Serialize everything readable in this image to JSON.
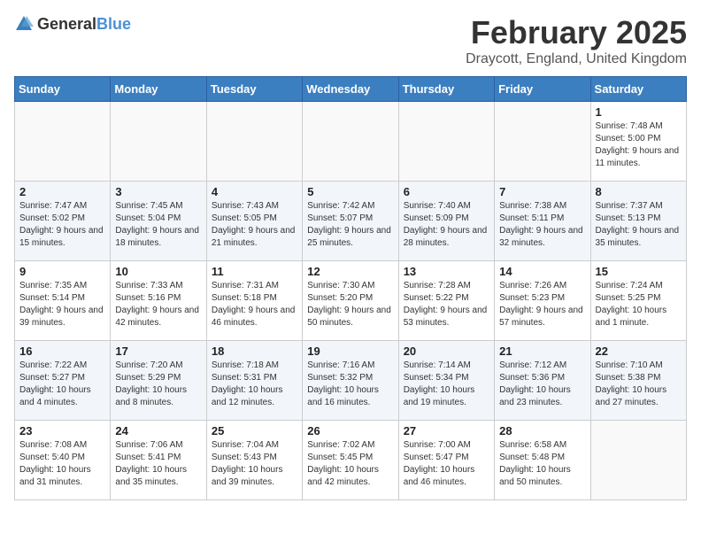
{
  "header": {
    "logo_general": "General",
    "logo_blue": "Blue",
    "month_year": "February 2025",
    "location": "Draycott, England, United Kingdom"
  },
  "weekdays": [
    "Sunday",
    "Monday",
    "Tuesday",
    "Wednesday",
    "Thursday",
    "Friday",
    "Saturday"
  ],
  "weeks": [
    [
      {
        "day": "",
        "info": ""
      },
      {
        "day": "",
        "info": ""
      },
      {
        "day": "",
        "info": ""
      },
      {
        "day": "",
        "info": ""
      },
      {
        "day": "",
        "info": ""
      },
      {
        "day": "",
        "info": ""
      },
      {
        "day": "1",
        "info": "Sunrise: 7:48 AM\nSunset: 5:00 PM\nDaylight: 9 hours and 11 minutes."
      }
    ],
    [
      {
        "day": "2",
        "info": "Sunrise: 7:47 AM\nSunset: 5:02 PM\nDaylight: 9 hours and 15 minutes."
      },
      {
        "day": "3",
        "info": "Sunrise: 7:45 AM\nSunset: 5:04 PM\nDaylight: 9 hours and 18 minutes."
      },
      {
        "day": "4",
        "info": "Sunrise: 7:43 AM\nSunset: 5:05 PM\nDaylight: 9 hours and 21 minutes."
      },
      {
        "day": "5",
        "info": "Sunrise: 7:42 AM\nSunset: 5:07 PM\nDaylight: 9 hours and 25 minutes."
      },
      {
        "day": "6",
        "info": "Sunrise: 7:40 AM\nSunset: 5:09 PM\nDaylight: 9 hours and 28 minutes."
      },
      {
        "day": "7",
        "info": "Sunrise: 7:38 AM\nSunset: 5:11 PM\nDaylight: 9 hours and 32 minutes."
      },
      {
        "day": "8",
        "info": "Sunrise: 7:37 AM\nSunset: 5:13 PM\nDaylight: 9 hours and 35 minutes."
      }
    ],
    [
      {
        "day": "9",
        "info": "Sunrise: 7:35 AM\nSunset: 5:14 PM\nDaylight: 9 hours and 39 minutes."
      },
      {
        "day": "10",
        "info": "Sunrise: 7:33 AM\nSunset: 5:16 PM\nDaylight: 9 hours and 42 minutes."
      },
      {
        "day": "11",
        "info": "Sunrise: 7:31 AM\nSunset: 5:18 PM\nDaylight: 9 hours and 46 minutes."
      },
      {
        "day": "12",
        "info": "Sunrise: 7:30 AM\nSunset: 5:20 PM\nDaylight: 9 hours and 50 minutes."
      },
      {
        "day": "13",
        "info": "Sunrise: 7:28 AM\nSunset: 5:22 PM\nDaylight: 9 hours and 53 minutes."
      },
      {
        "day": "14",
        "info": "Sunrise: 7:26 AM\nSunset: 5:23 PM\nDaylight: 9 hours and 57 minutes."
      },
      {
        "day": "15",
        "info": "Sunrise: 7:24 AM\nSunset: 5:25 PM\nDaylight: 10 hours and 1 minute."
      }
    ],
    [
      {
        "day": "16",
        "info": "Sunrise: 7:22 AM\nSunset: 5:27 PM\nDaylight: 10 hours and 4 minutes."
      },
      {
        "day": "17",
        "info": "Sunrise: 7:20 AM\nSunset: 5:29 PM\nDaylight: 10 hours and 8 minutes."
      },
      {
        "day": "18",
        "info": "Sunrise: 7:18 AM\nSunset: 5:31 PM\nDaylight: 10 hours and 12 minutes."
      },
      {
        "day": "19",
        "info": "Sunrise: 7:16 AM\nSunset: 5:32 PM\nDaylight: 10 hours and 16 minutes."
      },
      {
        "day": "20",
        "info": "Sunrise: 7:14 AM\nSunset: 5:34 PM\nDaylight: 10 hours and 19 minutes."
      },
      {
        "day": "21",
        "info": "Sunrise: 7:12 AM\nSunset: 5:36 PM\nDaylight: 10 hours and 23 minutes."
      },
      {
        "day": "22",
        "info": "Sunrise: 7:10 AM\nSunset: 5:38 PM\nDaylight: 10 hours and 27 minutes."
      }
    ],
    [
      {
        "day": "23",
        "info": "Sunrise: 7:08 AM\nSunset: 5:40 PM\nDaylight: 10 hours and 31 minutes."
      },
      {
        "day": "24",
        "info": "Sunrise: 7:06 AM\nSunset: 5:41 PM\nDaylight: 10 hours and 35 minutes."
      },
      {
        "day": "25",
        "info": "Sunrise: 7:04 AM\nSunset: 5:43 PM\nDaylight: 10 hours and 39 minutes."
      },
      {
        "day": "26",
        "info": "Sunrise: 7:02 AM\nSunset: 5:45 PM\nDaylight: 10 hours and 42 minutes."
      },
      {
        "day": "27",
        "info": "Sunrise: 7:00 AM\nSunset: 5:47 PM\nDaylight: 10 hours and 46 minutes."
      },
      {
        "day": "28",
        "info": "Sunrise: 6:58 AM\nSunset: 5:48 PM\nDaylight: 10 hours and 50 minutes."
      },
      {
        "day": "",
        "info": ""
      }
    ]
  ]
}
